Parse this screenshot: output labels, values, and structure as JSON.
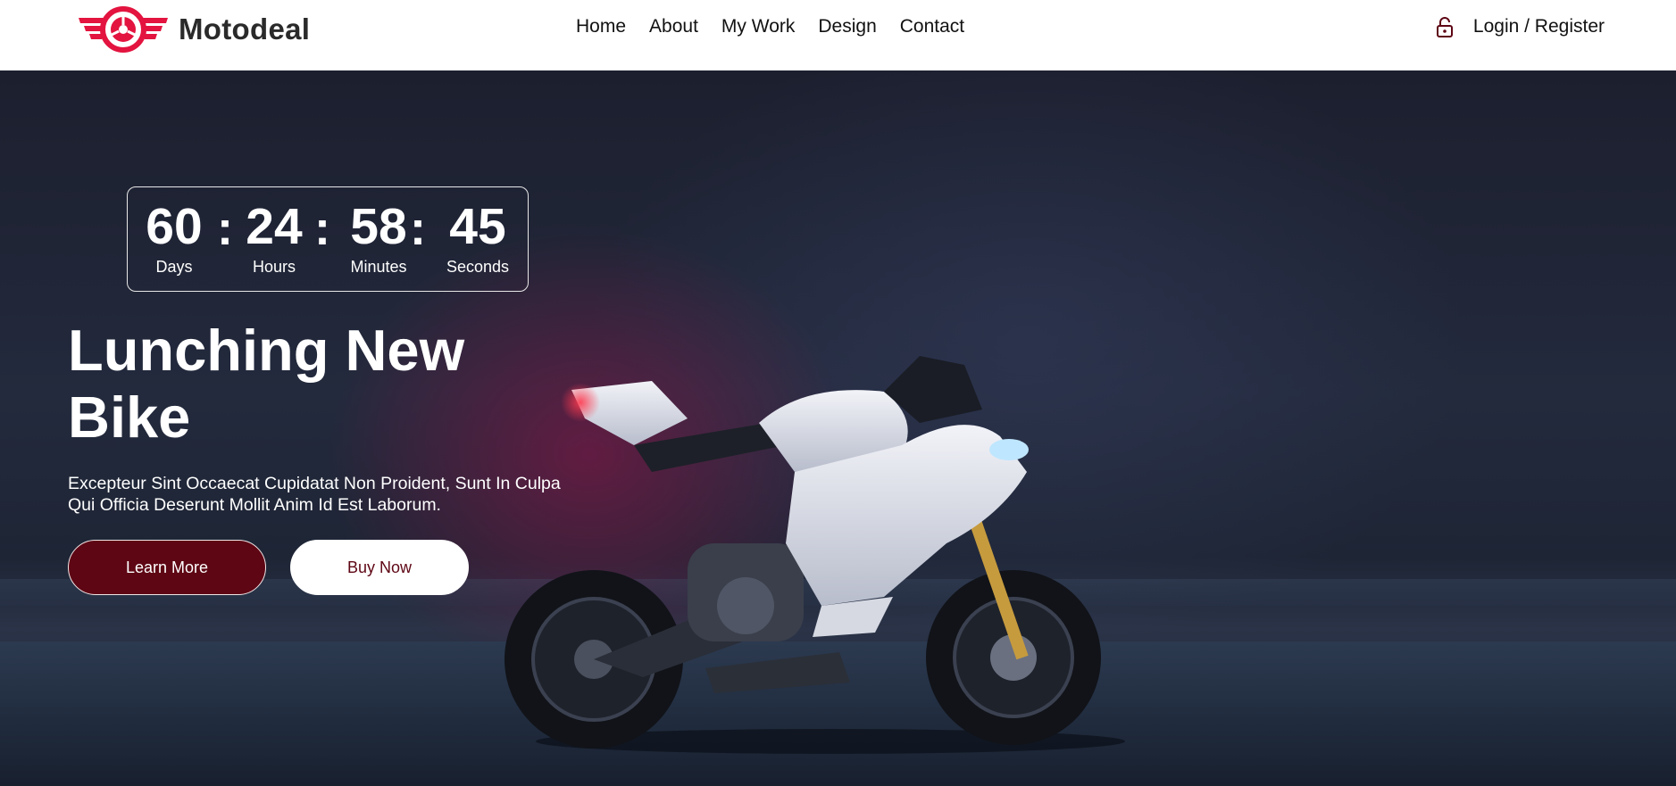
{
  "brand": {
    "name": "Motodeal",
    "accent": "#e3143f"
  },
  "nav": {
    "items": [
      {
        "label": "Home"
      },
      {
        "label": "About"
      },
      {
        "label": "My Work"
      },
      {
        "label": "Design"
      },
      {
        "label": "Contact"
      }
    ]
  },
  "auth": {
    "icon": "lock-icon",
    "label": "Login / Register"
  },
  "countdown": {
    "days": {
      "value": "60",
      "label": "Days"
    },
    "hours": {
      "value": "24",
      "label": "Hours"
    },
    "minutes": {
      "value": "58",
      "label": "Minutes"
    },
    "seconds": {
      "value": "45",
      "label": "Seconds"
    },
    "separator": ":"
  },
  "hero": {
    "title_line1": "Lunching New",
    "title_line2": "Bike",
    "description": "Excepteur Sint Occaecat Cupidatat Non Proident, Sunt In Culpa Qui Officia Deserunt Mollit Anim Id Est Laborum.",
    "learn_more_label": "Learn More",
    "buy_now_label": "Buy Now",
    "button_color": "#5e0614"
  }
}
